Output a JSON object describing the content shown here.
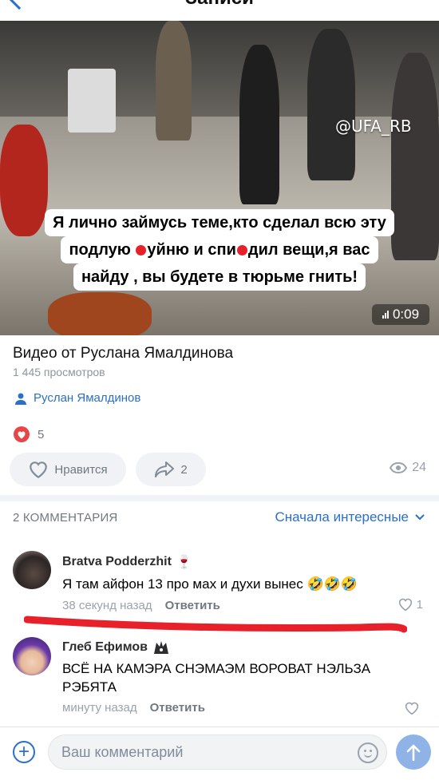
{
  "header": {
    "title": "Записи"
  },
  "video": {
    "watermark": "@UFA_RB",
    "duration": "0:09",
    "caption_lines": [
      [
        "Я лично займусь теме,кто сделал всю эту"
      ],
      [
        "подлую ",
        "уйню и спи",
        "дил вещи,я вас"
      ],
      [
        "найду , вы будете в тюрьме гнить!"
      ]
    ]
  },
  "post": {
    "title": "Видео от Руслана Ямалдинова",
    "views": "1 445 просмотров",
    "author": "Руслан Ямалдинов",
    "reaction_count": "5",
    "like_label": "Нравится",
    "share_count": "2",
    "view_count": "24"
  },
  "comments_section": {
    "header": "2 КОММЕНТАРИЯ",
    "sort_label": "Сначала интересные",
    "items": [
      {
        "name": "Bratva Podderzhit",
        "name_emoji": "🍷",
        "text": "Я там айфон 13 про мах и духи вынес",
        "emojis": "🤣🤣🤣",
        "time": "38 секунд назад",
        "reply": "Ответить",
        "likes": "1"
      },
      {
        "name": "Глеб Ефимов",
        "text_line1": "ВСЁ НА КАМЭРА СНЭМАЭМ ВОРОВАТ НЭЛЬЗА",
        "text_line2": "РЭБЯТА",
        "time": "минуту назад",
        "reply": "Ответить",
        "likes": ""
      }
    ]
  },
  "composer": {
    "placeholder": "Ваш комментарий"
  },
  "colors": {
    "accent": "#2a6fc9",
    "like_red": "#e64646",
    "annotation_red": "#e8202a"
  }
}
